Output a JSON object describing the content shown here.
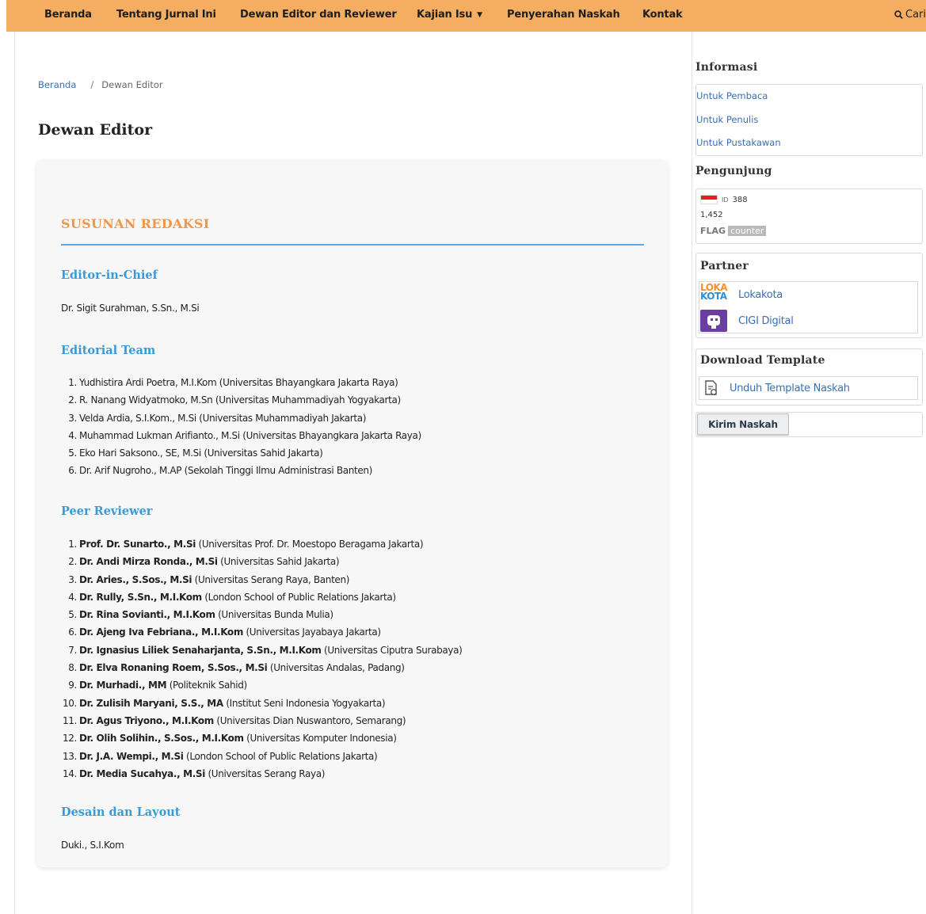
{
  "nav": {
    "items": [
      {
        "label": "Beranda"
      },
      {
        "label": "Tentang Jurnal Ini"
      },
      {
        "label": "Dewan Editor dan Reviewer"
      },
      {
        "label": "Kajian Isu",
        "has_dropdown": true
      },
      {
        "label": "Penyerahan Naskah"
      },
      {
        "label": "Kontak"
      }
    ],
    "search_label": "Cari",
    "search_icon": "search-icon",
    "background_color": "#f4ad61"
  },
  "breadcrumb": {
    "home": "Beranda",
    "separator": "/",
    "current": "Dewan Editor"
  },
  "page_title": "Dewan Editor",
  "content": {
    "section_title": "SUSUNAN REDAKSI",
    "editor_in_chief": {
      "heading": "Editor-in-Chief",
      "name": "Dr. Sigit Surahman, S.Sn., M.Si"
    },
    "editorial_team": {
      "heading": "Editorial Team",
      "members": [
        {
          "num": "1.",
          "text": "Yudhistira Ardi Poetra, M.I.Kom (Universitas Bhayangkara Jakarta Raya)"
        },
        {
          "num": "2.",
          "text": "R. Nanang Widyatmoko, M.Sn (Universitas Muhammadiyah Yogyakarta)"
        },
        {
          "num": "3.",
          "text": "Velda Ardia, S.I.Kom., M.Si (Universitas Muhammadiyah Jakarta)"
        },
        {
          "num": "4.",
          "text": "Muhammad Lukman Arifianto., M.Si (Universitas Bhayangkara Jakarta Raya)"
        },
        {
          "num": "5.",
          "text": "Eko Hari Saksono., SE, M.Si (Universitas Sahid Jakarta)"
        },
        {
          "num": "6.",
          "text": "Dr. Arif Nugroho., M.AP (Sekolah Tinggi Ilmu Administrasi Banten)"
        }
      ]
    },
    "peer_reviewer": {
      "heading": "Peer Reviewer",
      "members": [
        {
          "num": "1.",
          "name": "Prof. Dr. Sunarto., M.Si",
          "affiliation": "(Universitas Prof. Dr. Moestopo Beragama Jakarta)"
        },
        {
          "num": "2.",
          "name": "Dr. Andi Mirza Ronda., M.Si",
          "affiliation": "(Universitas Sahid Jakarta)"
        },
        {
          "num": "3.",
          "name": "Dr. Aries., S.Sos., M.Si",
          "affiliation": "(Universitas Serang Raya, Banten)"
        },
        {
          "num": "4.",
          "name": "Dr. Rully, S.Sn., M.I.Kom",
          "affiliation": "(London School of Public Relations Jakarta)"
        },
        {
          "num": "5.",
          "name": "Dr. Rina Sovianti., M.I.Kom",
          "affiliation": "(Universitas Bunda Mulia)"
        },
        {
          "num": "6.",
          "name": "Dr. Ajeng Iva Febriana., M.I.Kom",
          "affiliation": "(Universitas Jayabaya Jakarta)"
        },
        {
          "num": "7.",
          "name": "Dr. Ignasius Liliek Senaharjanta, S.Sn., M.I.Kom",
          "affiliation": "(Universitas Ciputra Surabaya)"
        },
        {
          "num": "8.",
          "name": "Dr. Elva Ronaning Roem, S.Sos., M.Si",
          "affiliation": "(Universitas Andalas, Padang)"
        },
        {
          "num": "9.",
          "name": "Dr. Murhadi., MM",
          "affiliation": "(Politeknik Sahid)"
        },
        {
          "num": "10.",
          "name": "Dr. Zulisih Maryani, S.S., MA",
          "affiliation": "(Institut Seni Indonesia Yogyakarta)"
        },
        {
          "num": "11.",
          "name": "Dr. Agus Triyono., M.I.Kom",
          "affiliation": "(Universitas Dian Nuswantoro, Semarang)"
        },
        {
          "num": "12.",
          "name": "Dr. Olih Solihin., S.Sos., M.I.Kom",
          "affiliation": "(Universitas Komputer Indonesia)"
        },
        {
          "num": "13.",
          "name": "Dr. J.A. Wempi., M.Si",
          "affiliation": "(London School of Public Relations Jakarta)"
        },
        {
          "num": "14.",
          "name": "Dr. Media Sucahya., M.Si",
          "affiliation": "(Universitas Serang Raya)"
        }
      ]
    },
    "design_layout": {
      "heading": "Desain dan Layout",
      "name": "Duki., S.I.Kom"
    },
    "section_title_color": "#f0974a",
    "heading_color": "#3a9ad9"
  },
  "sidebar": {
    "informasi": {
      "title": "Informasi",
      "links": [
        "Untuk Pembaca",
        "Untuk Penulis",
        "Untuk Pustakawan"
      ]
    },
    "pengunjung": {
      "title": "Pengunjung",
      "country_code": "ID",
      "country_count": "388",
      "total": "1,452",
      "counter_label_1": "FLAG",
      "counter_label_2": "counter"
    },
    "partner": {
      "title": "Partner",
      "items": [
        {
          "name": "Lokakota",
          "logo_line1": "LOKA",
          "logo_line2": "KOTA"
        },
        {
          "name": "CIGI Digital",
          "icon": "robot-icon"
        }
      ]
    },
    "download_template": {
      "title": "Download Template",
      "link": "Unduh Template Naskah",
      "icon": "document-icon"
    },
    "submit_button": "Kirim Naskah"
  }
}
